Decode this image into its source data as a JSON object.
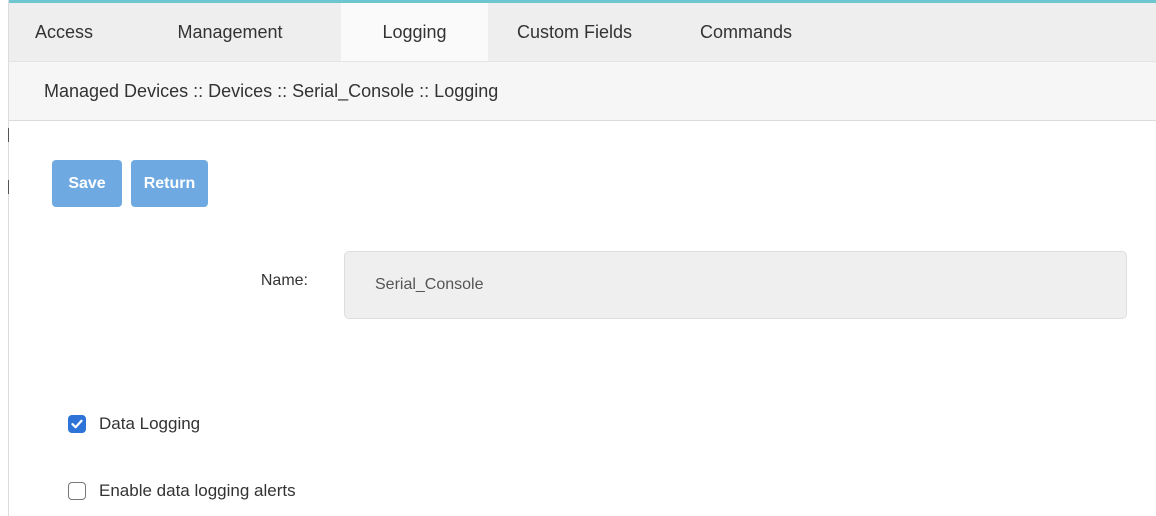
{
  "tabs": [
    {
      "label": "Access",
      "active": false
    },
    {
      "label": "Management",
      "active": false
    },
    {
      "label": "Logging",
      "active": true
    },
    {
      "label": "Custom Fields",
      "active": false
    },
    {
      "label": "Commands",
      "active": false
    }
  ],
  "breadcrumb": "Managed Devices :: Devices :: Serial_Console :: Logging",
  "toolbar": {
    "save_label": "Save",
    "return_label": "Return"
  },
  "form": {
    "name_label": "Name:",
    "name_value": "Serial_Console",
    "data_logging": {
      "label": "Data Logging",
      "checked": true
    },
    "enable_alerts": {
      "label": "Enable data logging alerts",
      "checked": false
    }
  },
  "colors": {
    "button": "#6ea9e2",
    "checkbox_checked": "#2e73d8",
    "accent": "#6ec6d0"
  },
  "icons": {
    "checkbox_checked": "checkmark-icon"
  }
}
